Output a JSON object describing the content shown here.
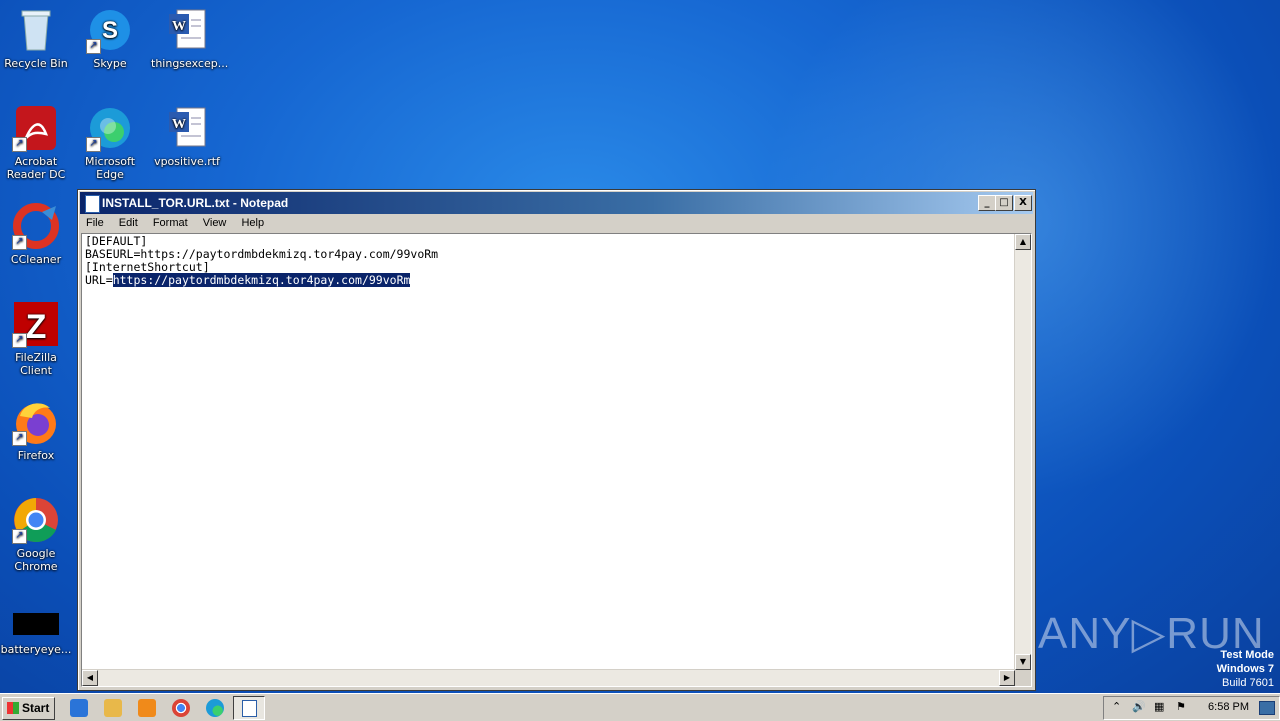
{
  "desktop": {
    "icons": [
      {
        "label": "Recycle Bin"
      },
      {
        "label": "Skype"
      },
      {
        "label": "thingsexcep..."
      },
      {
        "label": "Acrobat Reader DC"
      },
      {
        "label": "Microsoft Edge"
      },
      {
        "label": "vpositive.rtf"
      },
      {
        "label": "CCleaner"
      },
      {
        "label": "FileZilla Client"
      },
      {
        "label": "Firefox"
      },
      {
        "label": "Google Chrome"
      },
      {
        "label": "batteryeye..."
      }
    ]
  },
  "notepad": {
    "title": "INSTALL_TOR.URL.txt - Notepad",
    "menu": [
      "File",
      "Edit",
      "Format",
      "View",
      "Help"
    ],
    "lines": [
      "[DEFAULT]",
      "BASEURL=https://paytordmbdekmizq.tor4pay.com/99voRm",
      "[InternetShortcut]"
    ],
    "line4_prefix": "URL=",
    "line4_selected": "https://paytordmbdekmizq.tor4pay.com/99voRm",
    "min_label": "_",
    "max_label": "□",
    "close_label": "X"
  },
  "watermark": {
    "brand": "ANY▷RUN",
    "test_mode": "Test Mode",
    "os": "Windows 7",
    "build": "Build 7601"
  },
  "taskbar": {
    "start_label": "Start",
    "clock": "6:58 PM"
  }
}
